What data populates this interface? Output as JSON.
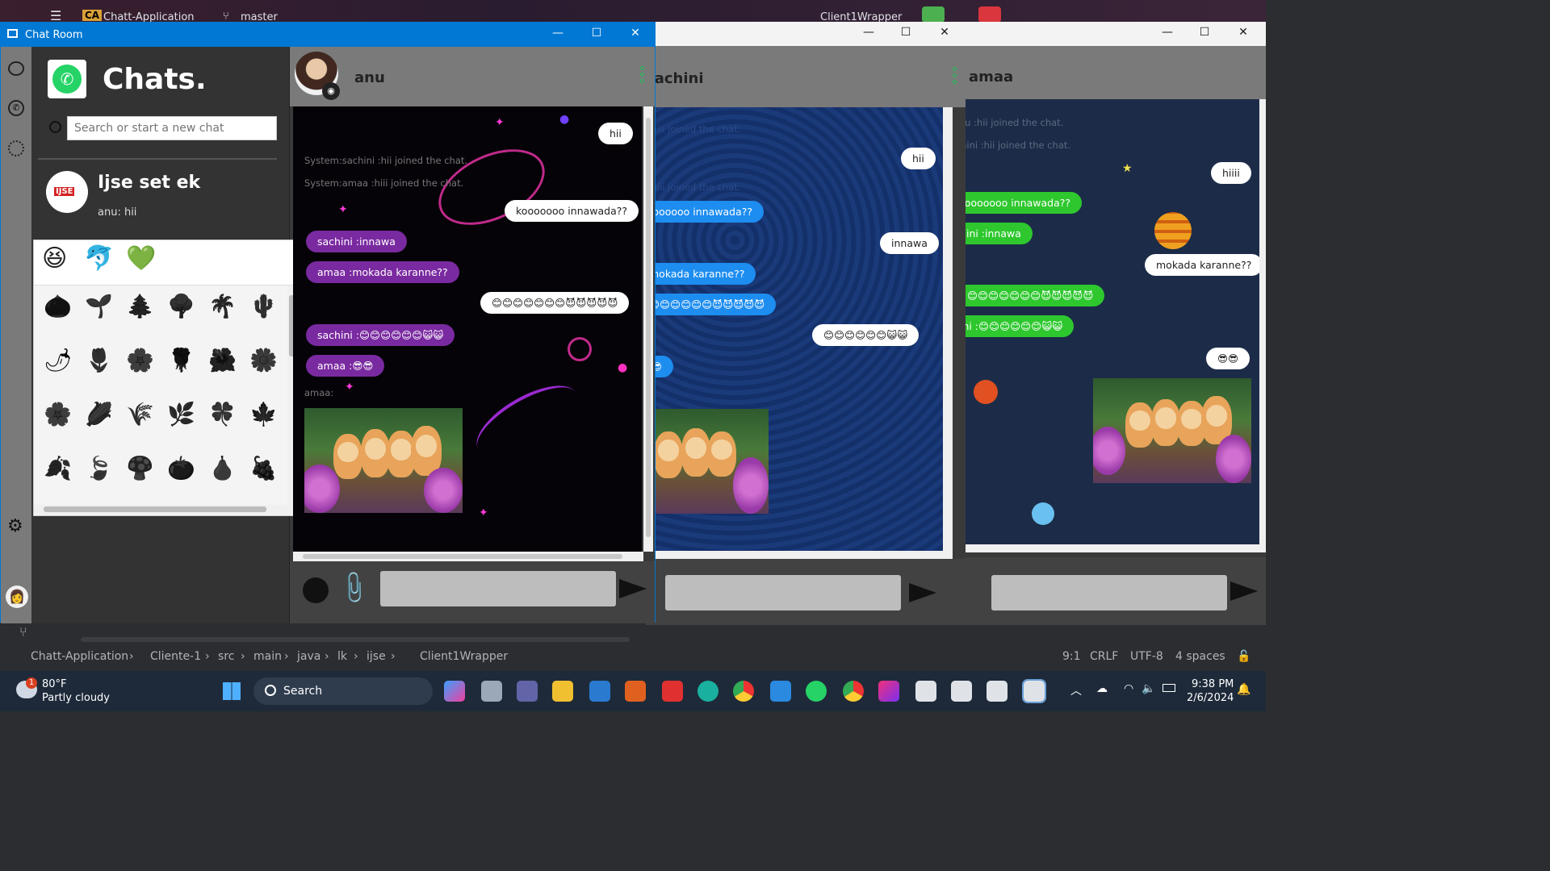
{
  "ide": {
    "app_badge": "CA",
    "project": "Chatt-Application",
    "branch": "master",
    "run_config": "Client1Wrapper",
    "breadcrumbs": [
      "Chatt-Application",
      "Cliente-1",
      "src",
      "main",
      "java",
      "lk",
      "ijse",
      "Client1Wrapper"
    ],
    "status": {
      "position": "9:1",
      "line_ending": "CRLF",
      "encoding": "UTF-8",
      "indent": "4 spaces"
    }
  },
  "window_main": {
    "title": "Chat Room",
    "sidebar": {
      "app_title": "Chats.",
      "search_placeholder": "Search or start a new chat",
      "chat_item": {
        "name": "Ijse set ek",
        "preview": "anu: hii",
        "logo_text": "IJSE"
      }
    },
    "emoji_tabs": [
      "😆",
      "🐬",
      "💚"
    ],
    "emoji_grid": [
      "🌰",
      "🌱",
      "🌲",
      "🌳",
      "🌴",
      "🌵",
      "🌶",
      "🌷",
      "🌸",
      "🌹",
      "🌺",
      "🌼",
      "🌸",
      "🌽",
      "🌾",
      "🌿",
      "🍀",
      "🍁",
      "🍂",
      "🍃",
      "🍄",
      "🍅",
      "🍐",
      "🍇"
    ],
    "chat": {
      "contact": "anu",
      "messages": [
        {
          "kind": "out",
          "text": "hii"
        },
        {
          "kind": "sys",
          "text": "System:sachini :hii  joined the chat."
        },
        {
          "kind": "sys",
          "text": "System:amaa :hiii  joined the chat."
        },
        {
          "kind": "out",
          "text": "kooooooo innawada??"
        },
        {
          "kind": "in",
          "text": "sachini :innawa"
        },
        {
          "kind": "in",
          "text": "amaa :mokada karanne??"
        },
        {
          "kind": "out",
          "text": "😊😊😊😊😊😊😊😈😈😈😈😈"
        },
        {
          "kind": "in",
          "text": "sachini :😊😊😊😊😊😊😺😺"
        },
        {
          "kind": "in",
          "text": "amaa :😎😎"
        },
        {
          "kind": "sys",
          "text": "amaa:"
        }
      ]
    }
  },
  "window_2": {
    "contact": "sachini",
    "messages": [
      {
        "kind": "sys",
        "text": "System:amaa :hiii  joined the chat."
      },
      {
        "kind": "out",
        "text": "hii"
      },
      {
        "kind": "sys",
        "text": "System:amaa :hiii  joined the chat."
      },
      {
        "kind": "in",
        "text": "kooooooo innawada??"
      },
      {
        "kind": "out",
        "text": "innawa"
      },
      {
        "kind": "in",
        "text": "mokada karanne??"
      },
      {
        "kind": "in",
        "text": "😊😊😊😊😊😊😈😈😈😈😈"
      },
      {
        "kind": "out",
        "text": "😊😊😊😊😊😊😺😺"
      },
      {
        "kind": "in",
        "text": "😎😎"
      }
    ]
  },
  "window_3": {
    "contact": "amaa",
    "messages": [
      {
        "kind": "sys",
        "text": "System:anu :hii  joined the chat."
      },
      {
        "kind": "sys",
        "text": "System:sachini :hii  joined the chat."
      },
      {
        "kind": "out",
        "text": "hiiii"
      },
      {
        "kind": "in",
        "text": "kooooooo innawada??"
      },
      {
        "kind": "in",
        "text": "sachini :innawa"
      },
      {
        "kind": "out",
        "text": "mokada karanne??"
      },
      {
        "kind": "in",
        "text": "😊😊😊😊😊😊😊😈😈😈😈😈"
      },
      {
        "kind": "in",
        "text": "sachini :😊😊😊😊😊😊😺😺"
      },
      {
        "kind": "out",
        "text": "😎😎"
      }
    ]
  },
  "taskbar": {
    "weather_temp": "80°F",
    "weather_desc": "Partly cloudy",
    "weather_badge": "1",
    "search_label": "Search",
    "time": "9:38 PM",
    "date": "2/6/2024"
  },
  "colors": {
    "accent": "#0078d4",
    "whatsapp_green": "#25d366",
    "purple_bubble": "#7a2aa0",
    "blue_bubble": "#1d8df0",
    "green_bubble": "#2ec82e"
  }
}
